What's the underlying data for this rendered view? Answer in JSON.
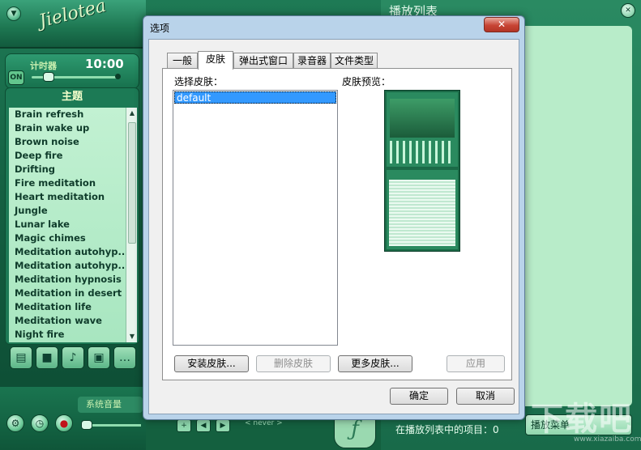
{
  "player": {
    "logo_text": "Jielotea",
    "timer": {
      "label": "计时器",
      "time": "10:00",
      "on_label": "ON"
    },
    "theme_header": "主题",
    "themes": [
      "Brain refresh",
      "Brain wake up",
      "Brown noise",
      "Deep fire",
      "Drifting",
      "Fire meditation",
      "Heart meditation",
      "Jungle",
      "Lunar lake",
      "Magic chimes",
      "Meditation autohyp...",
      "Meditation autohyp...",
      "Meditation hypnosis",
      "Meditation in desert",
      "Meditation life",
      "Meditation wave",
      "Night fire"
    ],
    "volume_label": "系统音量",
    "never_label": "< never >"
  },
  "playlist": {
    "title": "播放列表",
    "status": "在播放列表中的项目：0",
    "menu_label": "播放菜单"
  },
  "dialog": {
    "title": "选项",
    "close_label": "✕",
    "tabs": [
      {
        "label": "一般",
        "active": false
      },
      {
        "label": "皮肤",
        "active": true
      },
      {
        "label": "弹出式窗口",
        "active": false
      },
      {
        "label": "录音器",
        "active": false
      },
      {
        "label": "文件类型",
        "active": false
      }
    ],
    "skin_select_label": "选择皮肤：",
    "skin_preview_label": "皮肤预览：",
    "skins": [
      {
        "name": "default",
        "selected": true
      }
    ],
    "buttons": {
      "install": "安装皮肤...",
      "delete": "删除皮肤",
      "more": "更多皮肤...",
      "apply": "应用",
      "ok": "确定",
      "cancel": "取消"
    }
  },
  "watermark": {
    "text": "下载吧",
    "url": "www.xiazaiba.com"
  },
  "colors": {
    "player_green": "#1e7a55",
    "list_bg": "#b8ecc9",
    "selection_blue": "#3399ff",
    "close_red": "#c74535"
  }
}
